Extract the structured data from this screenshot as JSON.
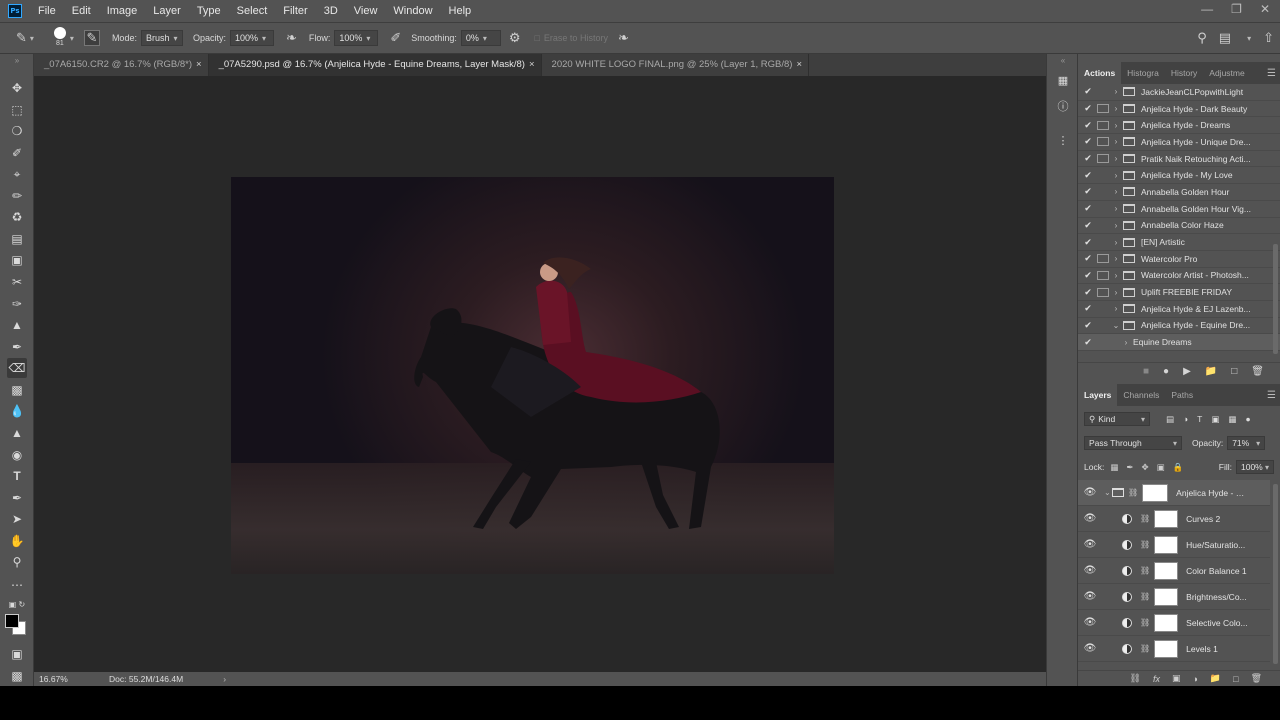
{
  "app": {
    "logo": "Ps"
  },
  "menu": [
    "File",
    "Edit",
    "Image",
    "Layer",
    "Type",
    "Select",
    "Filter",
    "3D",
    "View",
    "Window",
    "Help"
  ],
  "options": {
    "brush_size": "81",
    "mode_label": "Mode:",
    "mode_value": "Brush",
    "opacity_label": "Opacity:",
    "opacity_value": "100%",
    "flow_label": "Flow:",
    "flow_value": "100%",
    "smoothing_label": "Smoothing:",
    "smoothing_value": "0%",
    "erase_history": "Erase to History"
  },
  "tabs": [
    {
      "label": "_07A6150.CR2 @ 16.7% (RGB/8*)",
      "close": "×"
    },
    {
      "label": "_07A5290.psd @ 16.7% (Anjelica Hyde - Equine Dreams, Layer Mask/8)",
      "close": "×"
    },
    {
      "label": "2020 WHITE LOGO FINAL.png @ 25% (Layer 1, RGB/8)",
      "close": "×"
    }
  ],
  "status": {
    "zoom": "16.67%",
    "doc": "Doc: 55.2M/146.4M"
  },
  "actions_panel": {
    "tabs": [
      "Actions",
      "Histogra",
      "History",
      "Adjustme"
    ],
    "items": [
      {
        "label": "JackieJeanCLPopwithLight",
        "dialog": false,
        "expanded": false
      },
      {
        "label": "Anjelica Hyde - Dark Beauty",
        "dialog": true,
        "expanded": false
      },
      {
        "label": "Anjelica Hyde - Dreams",
        "dialog": true,
        "expanded": false
      },
      {
        "label": "Anjelica Hyde - Unique Dre...",
        "dialog": true,
        "expanded": false
      },
      {
        "label": "Pratik Naik Retouching Acti...",
        "dialog": true,
        "expanded": false
      },
      {
        "label": "Anjelica Hyde - My Love",
        "dialog": false,
        "expanded": false
      },
      {
        "label": "Annabella Golden Hour",
        "dialog": false,
        "expanded": false
      },
      {
        "label": "Annabella Golden Hour Vig...",
        "dialog": false,
        "expanded": false
      },
      {
        "label": "Annabella Color Haze",
        "dialog": false,
        "expanded": false
      },
      {
        "label": "[EN] Artistic",
        "dialog": false,
        "expanded": false
      },
      {
        "label": "Watercolor Pro",
        "dialog": true,
        "expanded": false
      },
      {
        "label": "Watercolor Artist - Photosh...",
        "dialog": true,
        "expanded": false
      },
      {
        "label": "Uplift FREEBIE FRIDAY",
        "dialog": true,
        "expanded": false
      },
      {
        "label": "Anjelica Hyde & EJ Lazenb...",
        "dialog": false,
        "expanded": false
      },
      {
        "label": "Anjelica Hyde - Equine Dre...",
        "dialog": false,
        "expanded": true
      }
    ],
    "sub_item": "Equine Dreams"
  },
  "layers_panel": {
    "tabs": [
      "Layers",
      "Channels",
      "Paths"
    ],
    "kind_label": "Kind",
    "blend_mode": "Pass Through",
    "opacity_label": "Opacity:",
    "opacity_value": "71%",
    "lock_label": "Lock:",
    "fill_label": "Fill:",
    "fill_value": "100%",
    "group_name": "Anjelica Hyde - E...",
    "layers": [
      "Curves 2",
      "Hue/Saturatio...",
      "Color Balance 1",
      "Brightness/Co...",
      "Selective Colo...",
      "Levels 1"
    ]
  },
  "icons": {
    "eye": "eye-icon",
    "check": "check-icon",
    "folder": "folder-icon",
    "link": "link-icon"
  }
}
